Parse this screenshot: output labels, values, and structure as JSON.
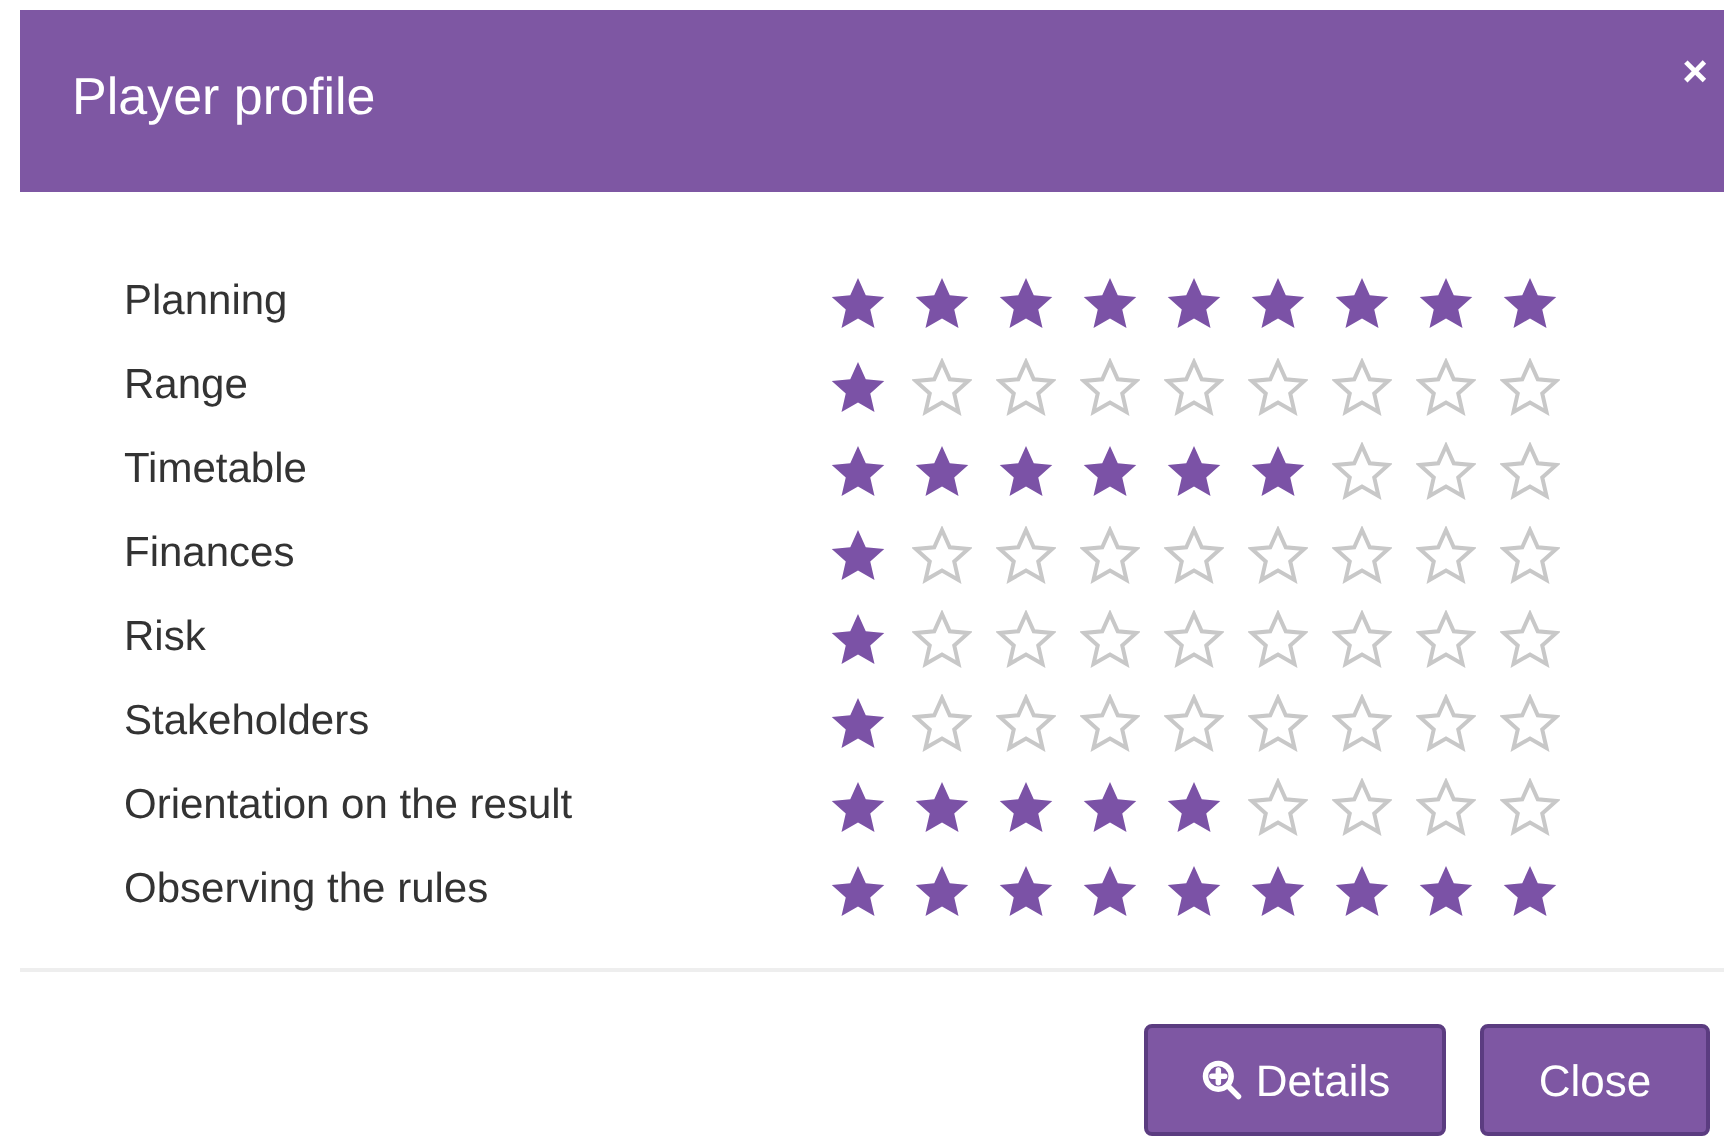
{
  "dialog": {
    "title": "Player profile",
    "close_glyph": "×"
  },
  "ratings": [
    {
      "label": "Planning",
      "stars": 9
    },
    {
      "label": "Range",
      "stars": 1
    },
    {
      "label": "Timetable",
      "stars": 6
    },
    {
      "label": "Finances",
      "stars": 1
    },
    {
      "label": "Risk",
      "stars": 1
    },
    {
      "label": "Stakeholders",
      "stars": 1
    },
    {
      "label": "Orientation on the result",
      "stars": 5
    },
    {
      "label": "Observing the rules",
      "stars": 9
    }
  ],
  "buttons": [
    {
      "label": "Details",
      "kind": "details"
    },
    {
      "label": "Close",
      "kind": "close"
    }
  ]
}
